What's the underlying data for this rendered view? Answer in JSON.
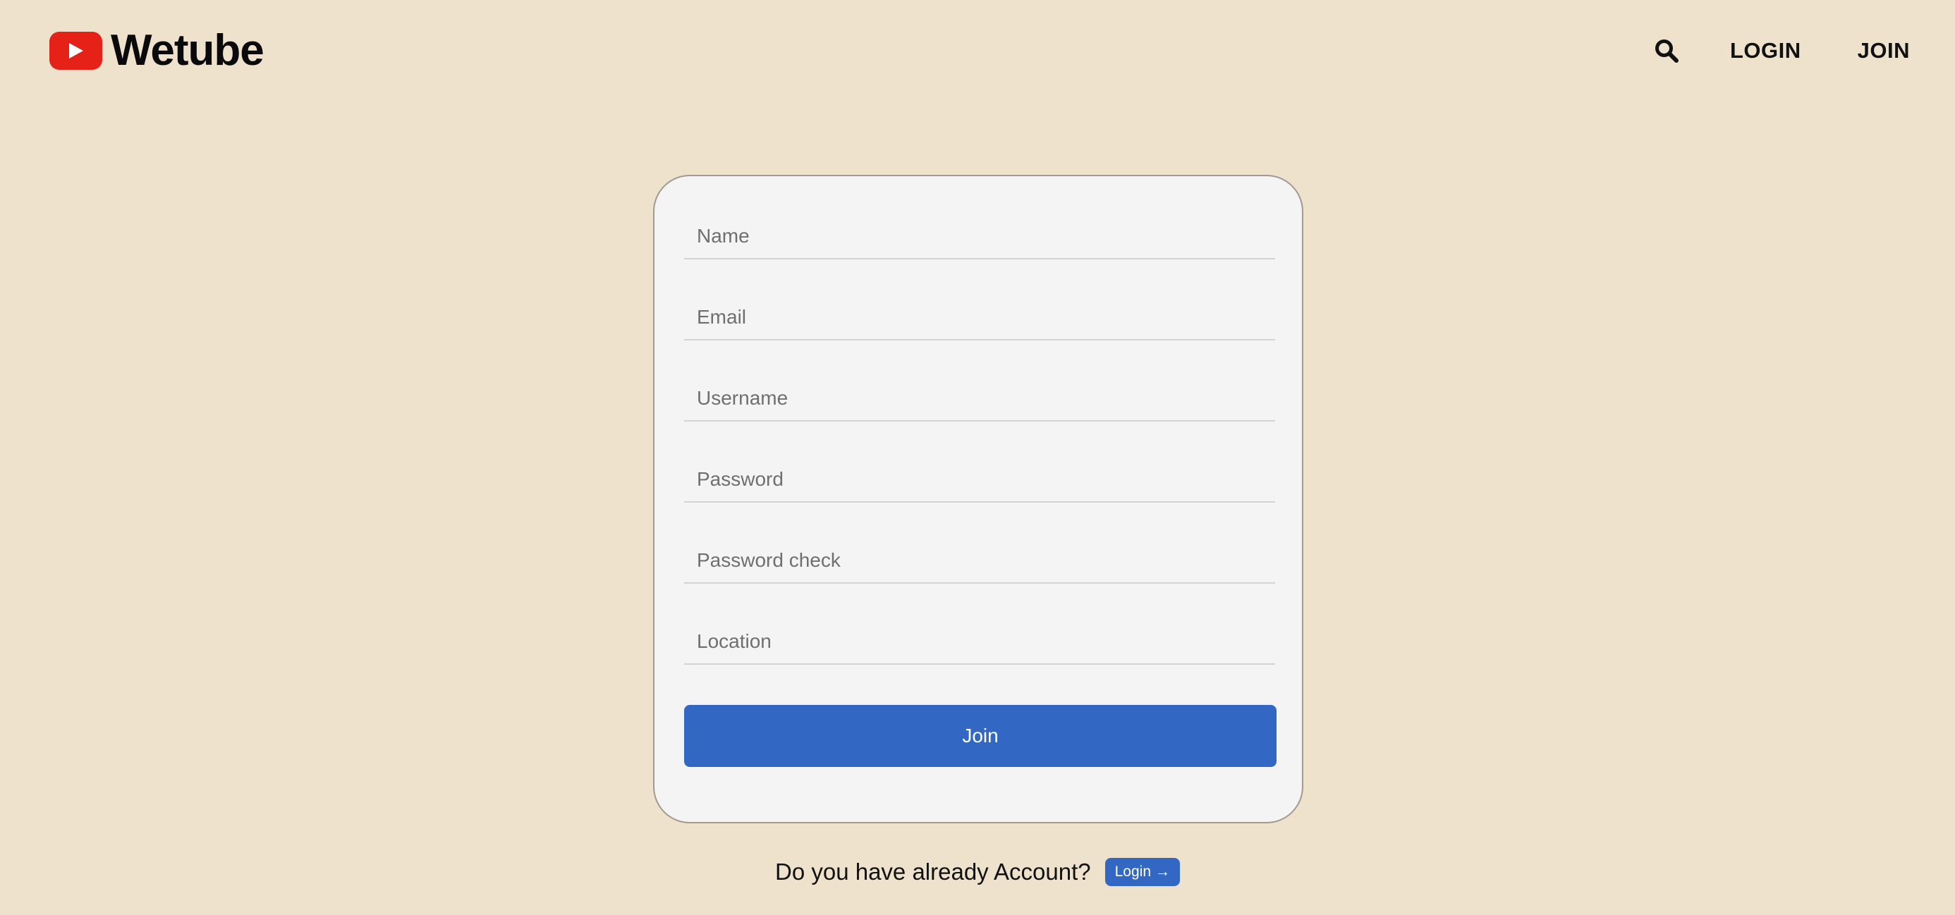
{
  "header": {
    "logo_text": "Wetube",
    "nav": {
      "login_label": "LOGIN",
      "join_label": "JOIN"
    }
  },
  "form": {
    "fields": [
      {
        "placeholder": "Name",
        "value": ""
      },
      {
        "placeholder": "Email",
        "value": ""
      },
      {
        "placeholder": "Username",
        "value": ""
      },
      {
        "placeholder": "Password",
        "value": ""
      },
      {
        "placeholder": "Password check",
        "value": ""
      },
      {
        "placeholder": "Location",
        "value": ""
      }
    ],
    "submit_label": "Join"
  },
  "footer": {
    "prompt": "Do you have already Account?",
    "login_label": "Login",
    "login_arrow": "→"
  },
  "colors": {
    "background": "#eee2cd",
    "card": "#f4f4f4",
    "accent": "#3367c4",
    "brand_red": "#e62117"
  },
  "icons": {
    "logo": "play-logo-icon",
    "search": "search-icon",
    "arrow": "arrow-right-icon"
  }
}
